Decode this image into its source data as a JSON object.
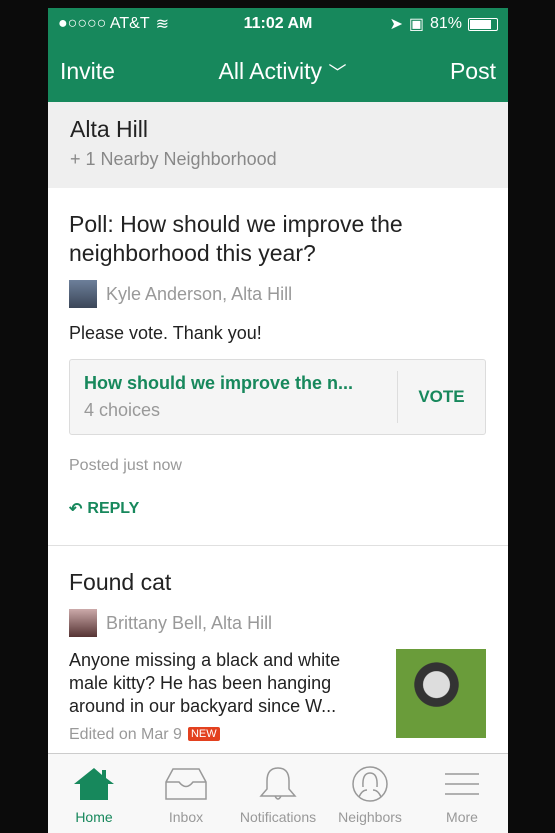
{
  "status": {
    "carrier": "●○○○○ AT&T",
    "time": "11:02 AM",
    "battery": "81%",
    "battery_level": 0.81
  },
  "nav": {
    "left": "Invite",
    "title": "All Activity",
    "right": "Post"
  },
  "header": {
    "title": "Alta Hill",
    "subtitle": "+ 1 Nearby Neighborhood"
  },
  "posts": [
    {
      "title": "Poll: How should we improve the neighborhood this year?",
      "author": "Kyle Anderson, Alta Hill",
      "body": "Please vote. Thank you!",
      "poll_question": "How should we improve the n...",
      "poll_choices": "4 choices",
      "vote": "VOTE",
      "meta": "Posted just now",
      "reply": "REPLY"
    },
    {
      "title": "Found cat",
      "author": "Brittany Bell, Alta Hill",
      "body": "Anyone missing a black and white male kitty? He has been hanging around in our backyard since W...",
      "meta": "Edited on Mar 9",
      "badge": "NEW"
    }
  ],
  "tabs": [
    {
      "label": "Home",
      "icon": "home-icon"
    },
    {
      "label": "Inbox",
      "icon": "inbox-icon"
    },
    {
      "label": "Notifications",
      "icon": "bell-icon"
    },
    {
      "label": "Neighbors",
      "icon": "person-icon"
    },
    {
      "label": "More",
      "icon": "menu-icon"
    }
  ],
  "colors": {
    "brand": "#17885c",
    "badge": "#e3411f"
  }
}
